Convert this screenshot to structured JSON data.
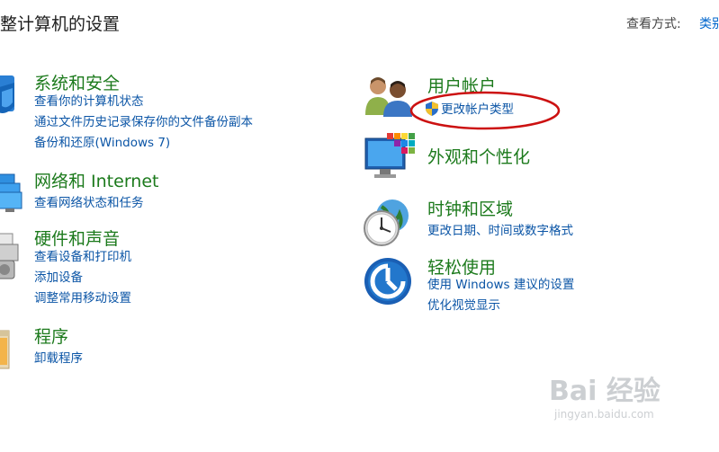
{
  "header": {
    "title": "整计算机的设置",
    "view_by_label": "查看方式:",
    "view_by_value": "类别"
  },
  "left_categories": [
    {
      "title": "系统和安全",
      "icon": "shield-computer-icon",
      "links": [
        "查看你的计算机状态",
        "通过文件历史记录保存你的文件备份副本",
        "备份和还原(Windows 7)"
      ]
    },
    {
      "title": "网络和 Internet",
      "icon": "network-icon",
      "links": [
        "查看网络状态和任务"
      ]
    },
    {
      "title": "硬件和声音",
      "icon": "printer-speaker-icon",
      "links": [
        "查看设备和打印机",
        "添加设备",
        "调整常用移动设置"
      ]
    },
    {
      "title": "程序",
      "icon": "programs-icon",
      "links": [
        "卸载程序"
      ]
    }
  ],
  "right_categories": [
    {
      "title": "用户帐户",
      "icon": "users-icon",
      "links": [
        "更改帐户类型"
      ]
    },
    {
      "title": "外观和个性化",
      "icon": "monitor-colors-icon",
      "links": []
    },
    {
      "title": "时钟和区域",
      "icon": "clock-globe-icon",
      "links": [
        "更改日期、时间或数字格式"
      ]
    },
    {
      "title": "轻松使用",
      "icon": "ease-of-access-icon",
      "links": [
        "使用 Windows 建议的设置",
        "优化视觉显示"
      ]
    }
  ],
  "watermark": {
    "brand": "Bai 经验",
    "domain": "jingyan.baidu.com"
  },
  "colors": {
    "category_title": "#1c7a1c",
    "link": "#0b55a6",
    "highlight": "#cc1111"
  }
}
